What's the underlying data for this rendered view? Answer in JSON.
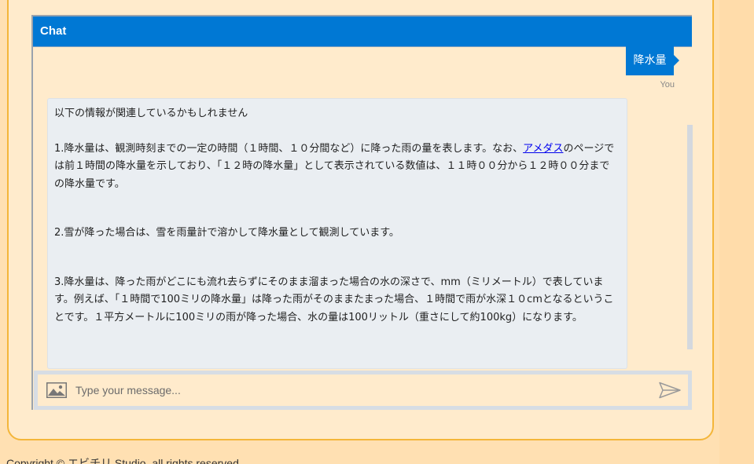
{
  "chat": {
    "title": "Chat",
    "user_message": "降水量",
    "sender_label": "You",
    "bot_message": {
      "intro": "以下の情報が関連しているかもしれません",
      "item1_before_link": "1.降水量は、観測時刻までの一定の時間（１時間、１０分間など）に降った雨の量を表します。なお、",
      "item1_link": "アメダス",
      "item1_after_link": "のページでは前１時間の降水量を示しており、「１２時の降水量」として表示されている数値は、１１時００分から１２時００分までの降水量です。",
      "item2": "2.雪が降った場合は、雪を雨量計で溶かして降水量として観測しています。",
      "item3": "3.降水量は、降った雨がどこにも流れ去らずにそのまま溜まった場合の水の深さで、mm（ミリメートル）で表しています。例えば、「１時間で100ミリの降水量」は降った雨がそのままたまった場合、１時間で雨が水深１０cmとなるということです。１平方メートルに100ミリの雨が降った場合、水の量は100リットル（重さにして約100kg）になります。"
    },
    "input": {
      "placeholder": "Type your message...",
      "value": ""
    },
    "icons": {
      "attach": "image-icon",
      "send": "send-icon"
    }
  },
  "footer": {
    "copyright": "Copyright © エビチリ Studio. all rights reserved."
  },
  "colors": {
    "page_background": "#ffe0b2",
    "card_background": "#ffebcc",
    "card_border": "#f4b63a",
    "accent": "#0078d4",
    "bot_bubble": "#eaeef2"
  }
}
